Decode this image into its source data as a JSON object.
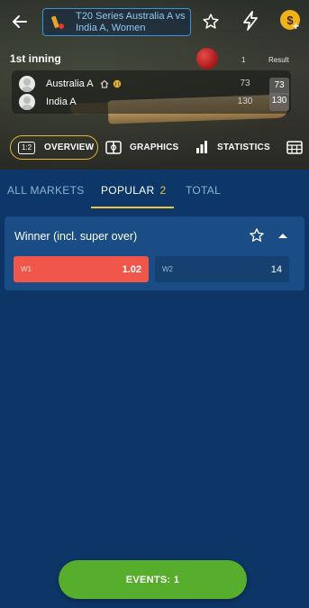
{
  "header": {
    "title": "T20 Series Australia A vs India A, Women"
  },
  "scoreboard": {
    "inning_label": "1st inning",
    "col_inning": "1",
    "col_result": "Result",
    "teams": [
      {
        "name": "Australia A",
        "inning": "73",
        "result": "73"
      },
      {
        "name": "India A",
        "inning": "130",
        "result": "130"
      }
    ]
  },
  "view_tabs": {
    "overview_icon": "1:2",
    "overview": "OVERVIEW",
    "graphics": "GRAPHICS",
    "statistics": "STATISTICS"
  },
  "market_tabs": {
    "all": "ALL MARKETS",
    "popular": "POPULAR",
    "popular_count": "2",
    "total": "TOTAL"
  },
  "market": {
    "title": "Winner (incl. super over)",
    "odds": [
      {
        "name": "W1",
        "value": "1.02"
      },
      {
        "name": "W2",
        "value": "14"
      }
    ]
  },
  "footer": {
    "events_button": "EVENTS: 1"
  },
  "colors": {
    "background": "#0d3566",
    "accent": "#f0c13a",
    "selected_odd": "#f0564a",
    "events_button": "#57ad2c"
  }
}
